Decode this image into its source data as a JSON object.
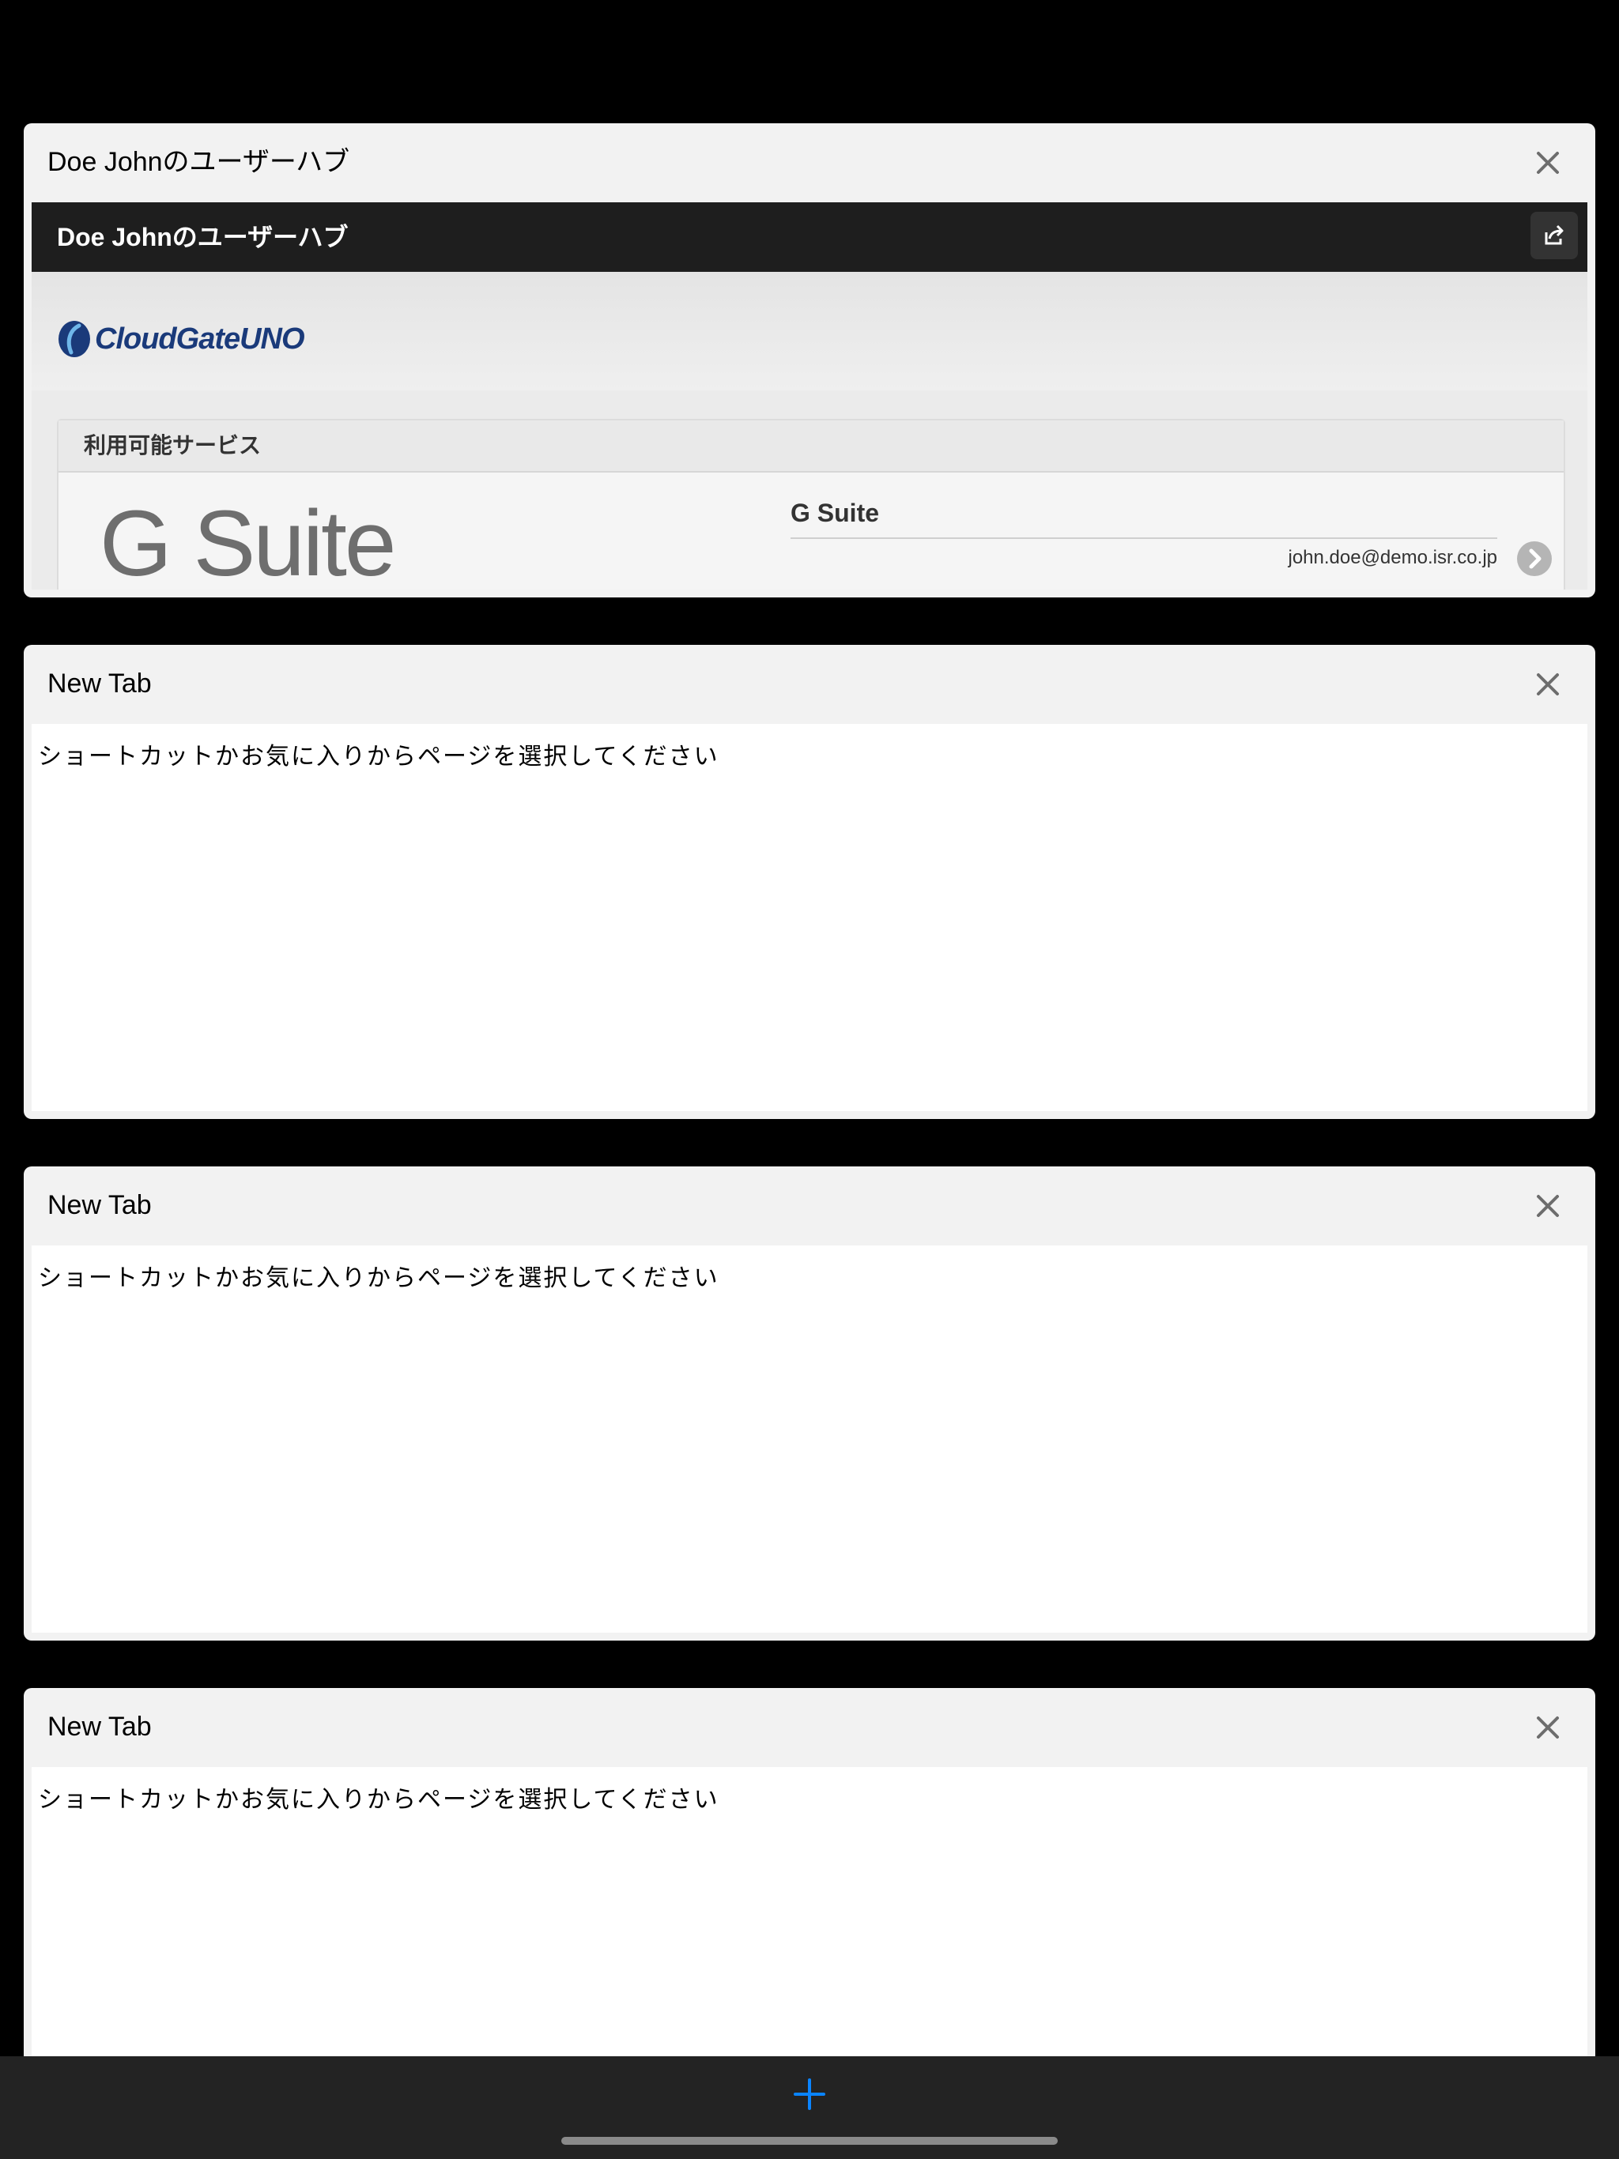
{
  "tabs": [
    {
      "title": "Doe Johnのユーザーハブ",
      "close_icon": "close-icon",
      "page": {
        "bar_title": "Doe Johnのユーザーハブ",
        "share_icon": "share-icon",
        "logo_text": "CloudGateUNO",
        "services_label": "利用可能サービス",
        "service": {
          "logo_text": "G Suite",
          "name": "G Suite",
          "account": "john.doe@demo.isr.co.jp",
          "go_icon": "chevron-right-circle-icon"
        }
      }
    },
    {
      "title": "New Tab",
      "message": "ショートカットかお気に入りからページを選択してください",
      "close_icon": "close-icon"
    },
    {
      "title": "New Tab",
      "message": "ショートカットかお気に入りからページを選択してください",
      "close_icon": "close-icon"
    },
    {
      "title": "New Tab",
      "message": "ショートカットかお気に入りからページを選択してください",
      "close_icon": "close-icon"
    }
  ],
  "toolbar": {
    "add_icon": "plus-icon"
  },
  "colors": {
    "background": "#000000",
    "card": "#f2f2f2",
    "hub_bar": "#1e1e1e",
    "accent": "#0a84ff",
    "logo": "#1a3a7a"
  }
}
